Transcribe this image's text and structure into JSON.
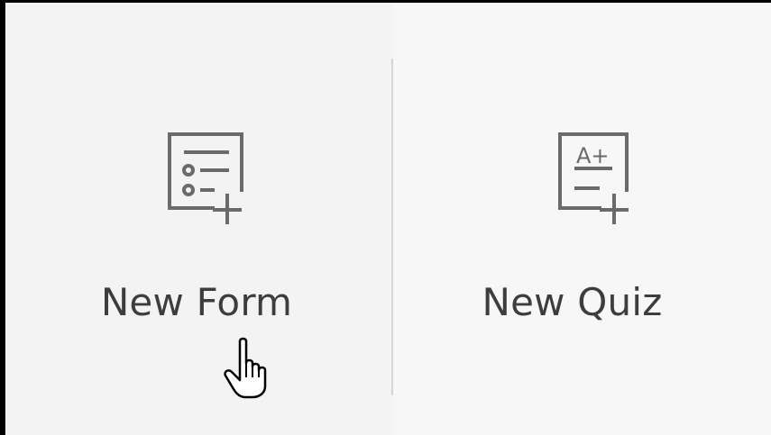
{
  "tiles": {
    "new_form": {
      "label": "New Form",
      "icon": "form-list-add-icon"
    },
    "new_quiz": {
      "label": "New Quiz",
      "icon": "quiz-grade-add-icon",
      "icon_text": "A+"
    }
  },
  "cursor": {
    "icon": "hand-pointer-icon"
  },
  "colors": {
    "icon_stroke": "#6a6a6a",
    "label_text": "#3d3d3d",
    "divider": "#d6d6d6",
    "background": "#f4f4f4",
    "frame_border": "#000000"
  }
}
